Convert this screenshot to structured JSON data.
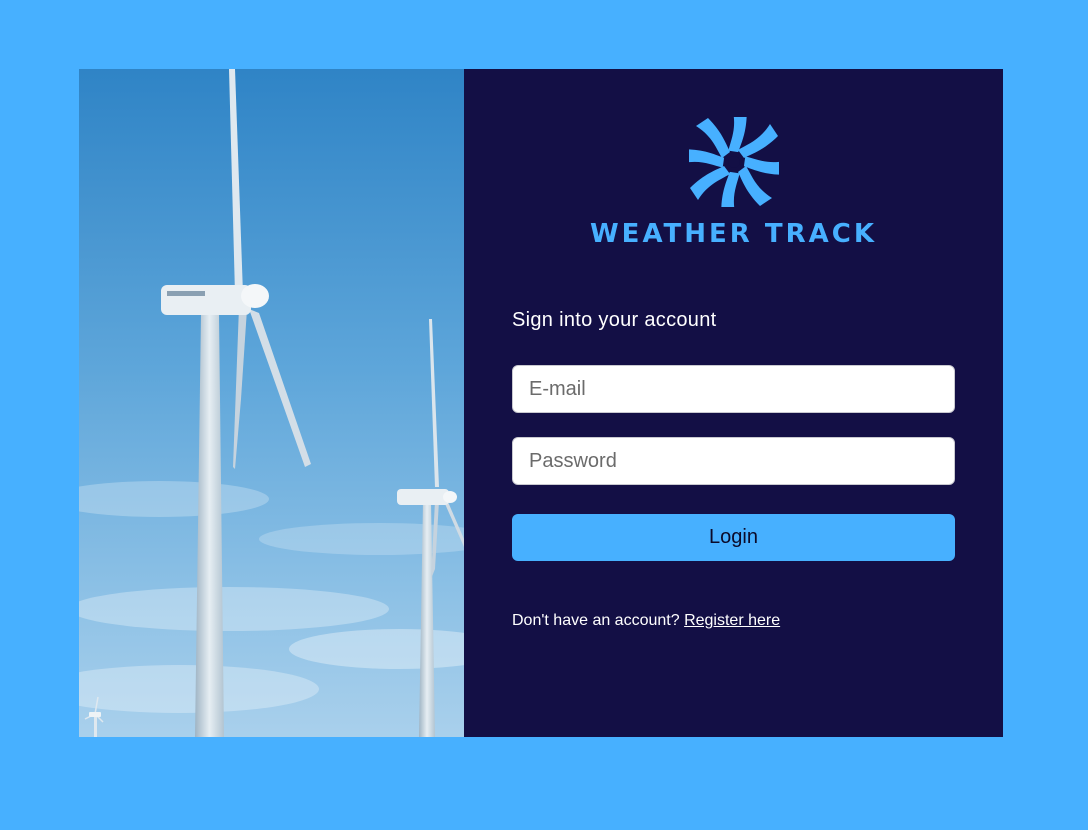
{
  "brand": {
    "name": "WEATHER TRACK",
    "logo_icon": "swirl-logo-icon",
    "accent_color": "#47b0ff"
  },
  "photo": {
    "subject": "wind-turbines-photo"
  },
  "login": {
    "heading": "Sign into your account",
    "email_placeholder": "E-mail",
    "email_value": "",
    "password_placeholder": "Password",
    "password_value": "",
    "login_label": "Login",
    "register_prompt": "Don't have an account?",
    "register_link": "Register here"
  },
  "colors": {
    "page_background": "#47b0ff",
    "panel_background": "#130f45",
    "button_background": "#47b0ff"
  }
}
